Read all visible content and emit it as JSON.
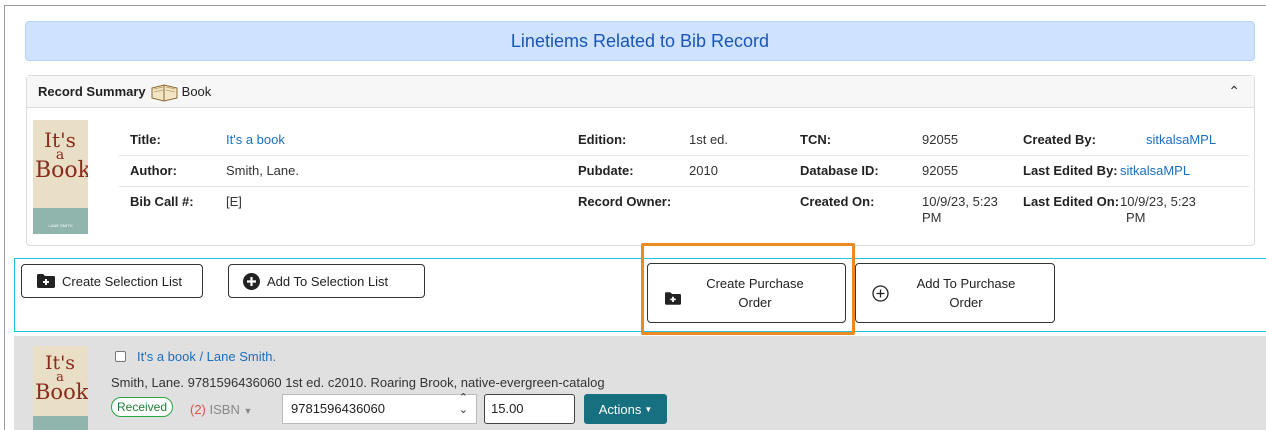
{
  "header": {
    "title": "Linetiems Related to Bib Record"
  },
  "summary": {
    "heading": "Record Summary",
    "format": "Book",
    "cover": {
      "line1": "It's",
      "line2": "a",
      "line3": "Book",
      "author_band": "LANE SMITH"
    },
    "fields": {
      "title_label": "Title:",
      "title_value": "It's a book",
      "author_label": "Author:",
      "author_value": "Smith, Lane.",
      "callnum_label": "Bib Call #:",
      "callnum_value": "[E]",
      "edition_label": "Edition:",
      "edition_value": "1st ed.",
      "pubdate_label": "Pubdate:",
      "pubdate_value": "2010",
      "owner_label": "Record Owner:",
      "owner_value": "",
      "tcn_label": "TCN:",
      "tcn_value": "92055",
      "dbid_label": "Database ID:",
      "dbid_value": "92055",
      "created_on_label": "Created On:",
      "created_on_value_1": "10/9/23, 5:23",
      "created_on_value_2": "PM",
      "created_by_label": "Created By:",
      "created_by_value": "sitkalsaMPL",
      "edited_by_label": "Last Edited By:",
      "edited_by_value": "sitkalsaMPL",
      "edited_on_label": "Last Edited On:",
      "edited_on_value_1": "10/9/23, 5:23",
      "edited_on_value_2": "PM"
    }
  },
  "actions": {
    "create_selection_list": "Create Selection List",
    "add_to_selection_list": "Add To Selection List",
    "create_po_line1": "Create Purchase",
    "create_po_line2": "Order",
    "add_po_line1": "Add To Purchase",
    "add_po_line2": "Order"
  },
  "lineitem": {
    "cover": {
      "line1": "It's",
      "line2": "a",
      "line3": "Book"
    },
    "title_link": "It's a book / Lane Smith.",
    "details": "Smith, Lane. 9781596436060  1st ed. c2010. Roaring Brook, native-evergreen-catalog",
    "status_badge": "Received",
    "count": "(2)",
    "ident_type": "ISBN",
    "ident_value": "9781596436060",
    "price": "15.00",
    "actions_label": "Actions"
  },
  "colors": {
    "header_bg": "#cfe2ff",
    "header_text": "#1a56b5",
    "highlight": "#ec8a21",
    "actions_button": "#17707f",
    "badge_green": "#28a745"
  }
}
